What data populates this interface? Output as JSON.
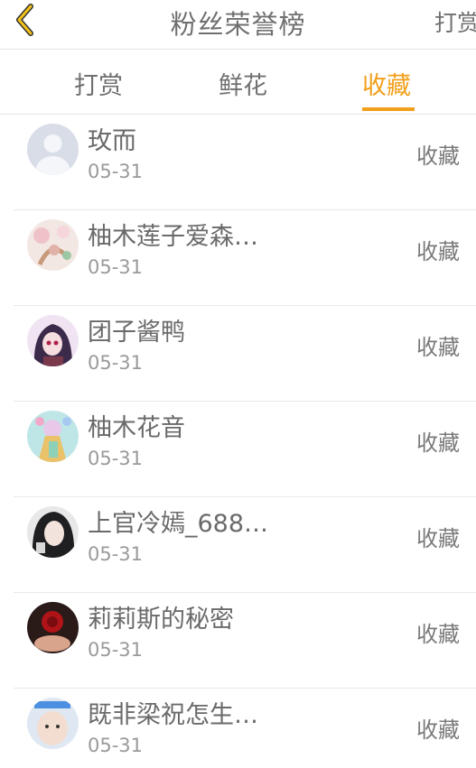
{
  "header": {
    "title": "粉丝荣誉榜",
    "right_label": "打赏"
  },
  "tabs": [
    {
      "label": "打赏",
      "active": false
    },
    {
      "label": "鲜花",
      "active": false
    },
    {
      "label": "收藏",
      "active": true
    }
  ],
  "colors": {
    "accent": "#f2a01b",
    "text": "#6a6a6a",
    "muted": "#9a9a9a"
  },
  "list": [
    {
      "name": "玫而",
      "date": "05-31",
      "action": "收藏",
      "avatar": "default-avatar"
    },
    {
      "name": "柚木莲子爱森…",
      "date": "05-31",
      "action": "收藏",
      "avatar": "floral-avatar"
    },
    {
      "name": "团子酱鸭",
      "date": "05-31",
      "action": "收藏",
      "avatar": "anime-girl-avatar"
    },
    {
      "name": "柚木花音",
      "date": "05-31",
      "action": "收藏",
      "avatar": "colorful-anime-avatar"
    },
    {
      "name": "上官冷嫣_688…",
      "date": "05-31",
      "action": "收藏",
      "avatar": "dark-hair-avatar"
    },
    {
      "name": "莉莉斯的秘密",
      "date": "05-31",
      "action": "收藏",
      "avatar": "red-rose-avatar"
    },
    {
      "name": "既非梁祝怎生…",
      "date": "05-31",
      "action": "收藏",
      "avatar": "child-photo-avatar"
    }
  ]
}
